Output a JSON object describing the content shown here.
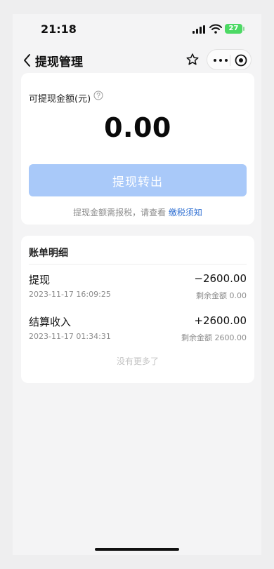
{
  "status_bar": {
    "time": "21:18",
    "battery": "27",
    "icons": [
      "signal-icon",
      "wifi-icon",
      "battery-icon"
    ]
  },
  "nav": {
    "title": "提现管理",
    "icons": [
      "back-icon",
      "star-icon",
      "more-icon",
      "target-icon"
    ]
  },
  "balance": {
    "label": "可提现金额(元)",
    "amount": "0.00",
    "button_label": "提现转出",
    "tax_note": "提现金额需报税，请查看",
    "tax_link": "缴税须知",
    "button_color": "#a9c9f9",
    "link_color": "#2f6fd2"
  },
  "details": {
    "title": "账单明细",
    "records": [
      {
        "title": "提现",
        "amount": "−2600.00",
        "time": "2023-11-17 16:09:25",
        "balance": "剩余金额 0.00"
      },
      {
        "title": "结算收入",
        "amount": "+2600.00",
        "time": "2023-11-17 01:34:31",
        "balance": "剩余金额 2600.00"
      }
    ],
    "no_more": "没有更多了"
  }
}
